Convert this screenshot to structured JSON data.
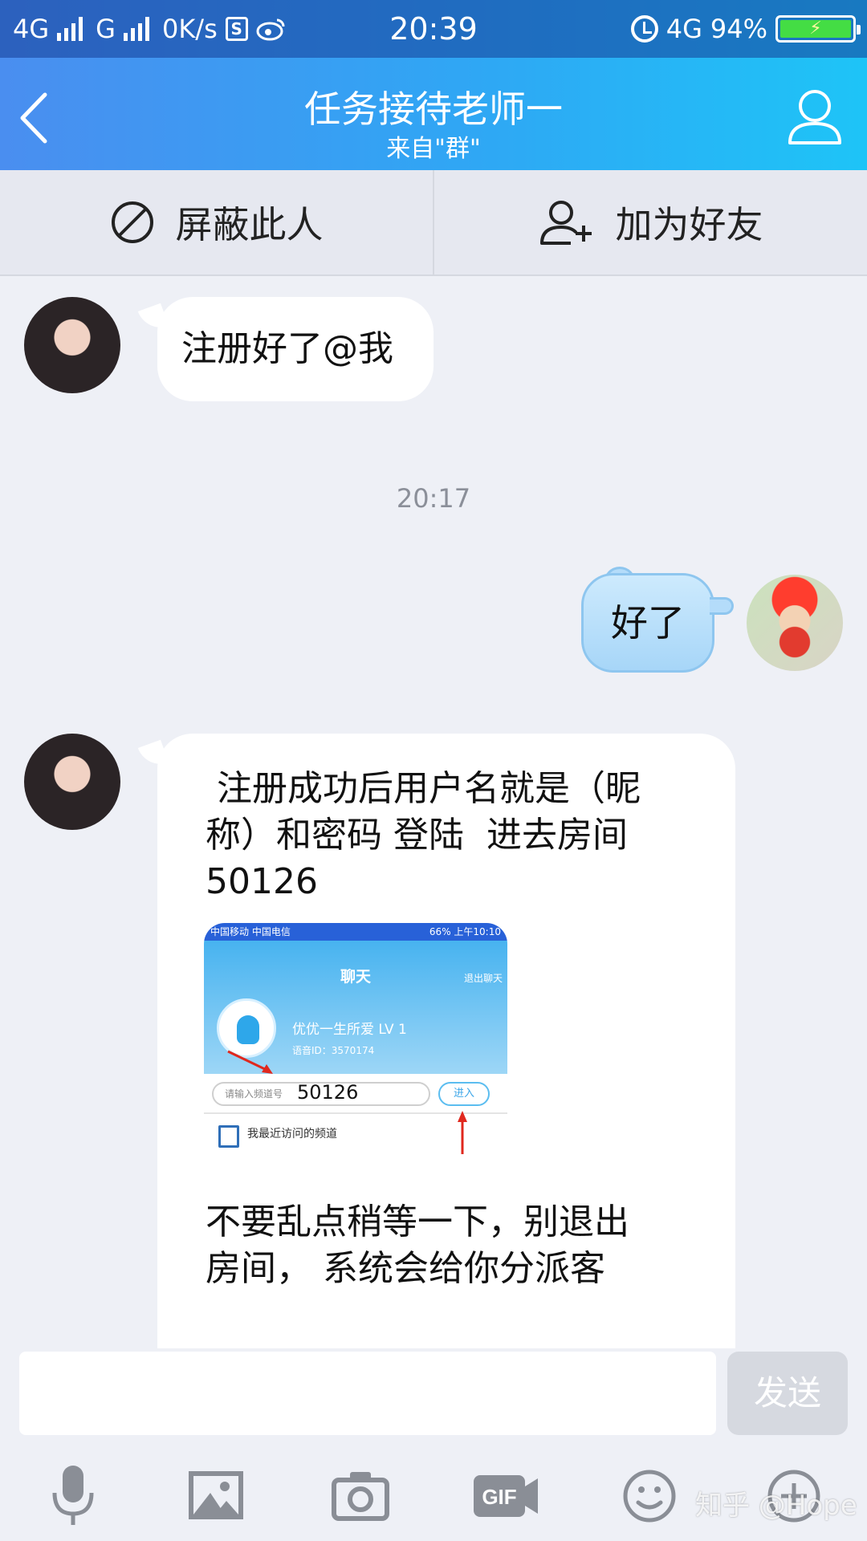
{
  "status_bar": {
    "network1": "4G",
    "network2": "G",
    "speed": "0K/s",
    "time": "20:39",
    "network3": "4G",
    "battery": "94%"
  },
  "header": {
    "title": "任务接待老师一",
    "subtitle": "来自\"群\""
  },
  "actions": {
    "block_label": "屏蔽此人",
    "add_friend_label": "加为好友"
  },
  "messages": [
    {
      "from": "other",
      "text": "注册好了@我"
    },
    {
      "timestamp": "20:17"
    },
    {
      "from": "me",
      "text": "好了"
    },
    {
      "from": "other",
      "text_lines": [
        " 注册成功后用户名就是（昵",
        "称）和密码 登陆  进去房间",
        "50126"
      ],
      "tail_line": "不要乱点稍等一下，别退出",
      "tail_line2": "房间，  系统会给你分派客",
      "embedded_screenshot": {
        "status_left": "中国移动  中国电信",
        "status_right": "66%  上午10:10",
        "title": "聊天",
        "exit_label": "退出聊天",
        "user_name": "优优一生所爱  LV 1",
        "user_id": "语音ID：3570174",
        "input_placeholder": "请输入频道号",
        "input_value": "50126",
        "enter_label": "进入",
        "recent_label": "我最近访问的频道"
      }
    }
  ],
  "composer": {
    "input_value": "",
    "send_label": "发送"
  },
  "toolbar": {
    "icons": [
      "microphone-icon",
      "image-icon",
      "camera-icon",
      "gif-icon",
      "emoji-icon",
      "plus-icon"
    ],
    "gif_label": "GIF"
  },
  "watermark": "知乎 @Hope",
  "colors": {
    "header_start": "#4a8ef0",
    "header_end": "#1ec4f7",
    "outgoing_bubble": "#a7d6f8",
    "send_disabled": "#d6d9e0"
  }
}
